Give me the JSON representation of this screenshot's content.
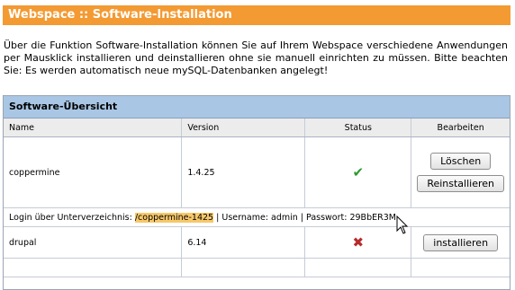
{
  "header": {
    "title": "Webspace :: Software-Installation"
  },
  "intro": {
    "text": "Über die Funktion Software-Installation können Sie auf Ihrem Webspace verschiedene Anwendungen per Mausklick installieren und deinstallieren ohne sie manuell einrichten zu müssen. Bitte beachten Sie: Es werden automatisch neue mySQL-Datenbanken angelegt!"
  },
  "panel": {
    "title": "Software-Übersicht",
    "columns": {
      "name": "Name",
      "version": "Version",
      "status": "Status",
      "edit": "Bearbeiten"
    },
    "rows": [
      {
        "name": "coppermine",
        "version": "1.4.25",
        "status_icon": "check-icon",
        "status_color": "#2e9a2e",
        "buttons": {
          "delete": "Löschen",
          "reinstall": "Reinstallieren"
        },
        "login": {
          "prefix": "Login über Unterverzeichnis:",
          "path": "/coppermine-1425",
          "user": "| Username: admin | Passwort: 29BbER3M"
        }
      },
      {
        "name": "drupal",
        "version": "6.14",
        "status_icon": "cross-icon",
        "status_color": "#b82a2a",
        "buttons": {
          "install": "installieren"
        }
      }
    ]
  },
  "colors": {
    "header_bg": "#f39a33",
    "panel_head_bg": "#a9c6e4",
    "highlight": "#f7c86a"
  }
}
